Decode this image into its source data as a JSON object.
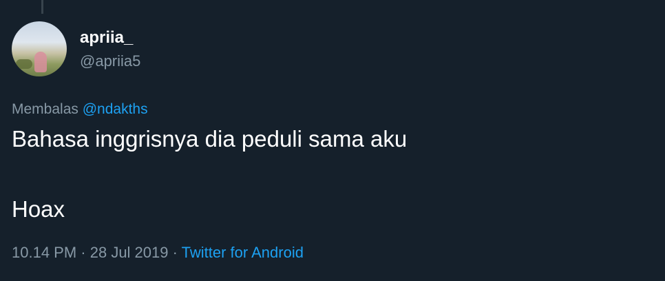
{
  "user": {
    "name": "apriia_",
    "handle": "@apriia5"
  },
  "reply": {
    "prefix": "Membalas",
    "mention": "@ndakths"
  },
  "tweet": {
    "line1": "Bahasa inggrisnya dia peduli sama aku",
    "line2": "Hoax"
  },
  "meta": {
    "time": "10.14 PM",
    "separator1": " · ",
    "date": "28 Jul 2019",
    "separator2": " · ",
    "source": "Twitter for Android"
  },
  "colors": {
    "background": "#15202b",
    "text": "#ffffff",
    "secondary": "#8899a6",
    "accent": "#1da1f2"
  }
}
